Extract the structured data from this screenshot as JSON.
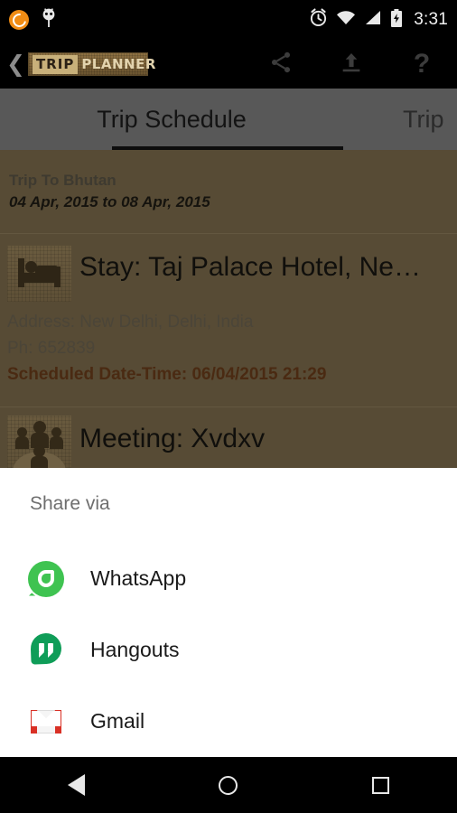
{
  "status_bar": {
    "time": "3:31",
    "left_icons": [
      "orange-circle-notification-icon",
      "android-bug-notification-icon"
    ],
    "right_icons": [
      "alarm-icon",
      "wifi-icon",
      "signal-icon",
      "battery-charging-icon"
    ]
  },
  "action_bar": {
    "back_label": "❮",
    "logo_part1": "TRIP",
    "logo_part2": "PLANNER",
    "actions": [
      {
        "name": "share-icon",
        "label": "Share"
      },
      {
        "name": "export-icon",
        "label": "Export"
      },
      {
        "name": "help-icon",
        "label": "?"
      }
    ]
  },
  "tabs": [
    {
      "label": "Trip Schedule",
      "selected": true
    },
    {
      "label": "Trip",
      "selected": false
    }
  ],
  "trip": {
    "title": "Trip To Bhutan",
    "dates": "04 Apr, 2015 to 08 Apr, 2015",
    "items": [
      {
        "icon": "bed-icon",
        "title": "Stay: Taj Palace Hotel, Ne…",
        "address": "Address: New Delhi, Delhi, India",
        "phone": "Ph: 652839",
        "scheduled": "Scheduled Date-Time: 06/04/2015 21:29"
      },
      {
        "icon": "meeting-icon",
        "title": "Meeting: Xvdxv"
      }
    ]
  },
  "share_sheet": {
    "title": "Share via",
    "apps": [
      {
        "name": "whatsapp",
        "label": "WhatsApp",
        "color": "#3fc351"
      },
      {
        "name": "hangouts",
        "label": "Hangouts",
        "color": "#0f9d58"
      },
      {
        "name": "gmail",
        "label": "Gmail",
        "color": "#d93025"
      }
    ]
  },
  "nav_bar": {
    "back": "back-triangle-icon",
    "home": "home-circle-icon",
    "recents": "recents-square-icon"
  },
  "colors": {
    "scrim_background": "#574b35",
    "tab_background": "#585858",
    "sheet_background": "#ffffff",
    "scheduled_text": "#4a2a12"
  }
}
